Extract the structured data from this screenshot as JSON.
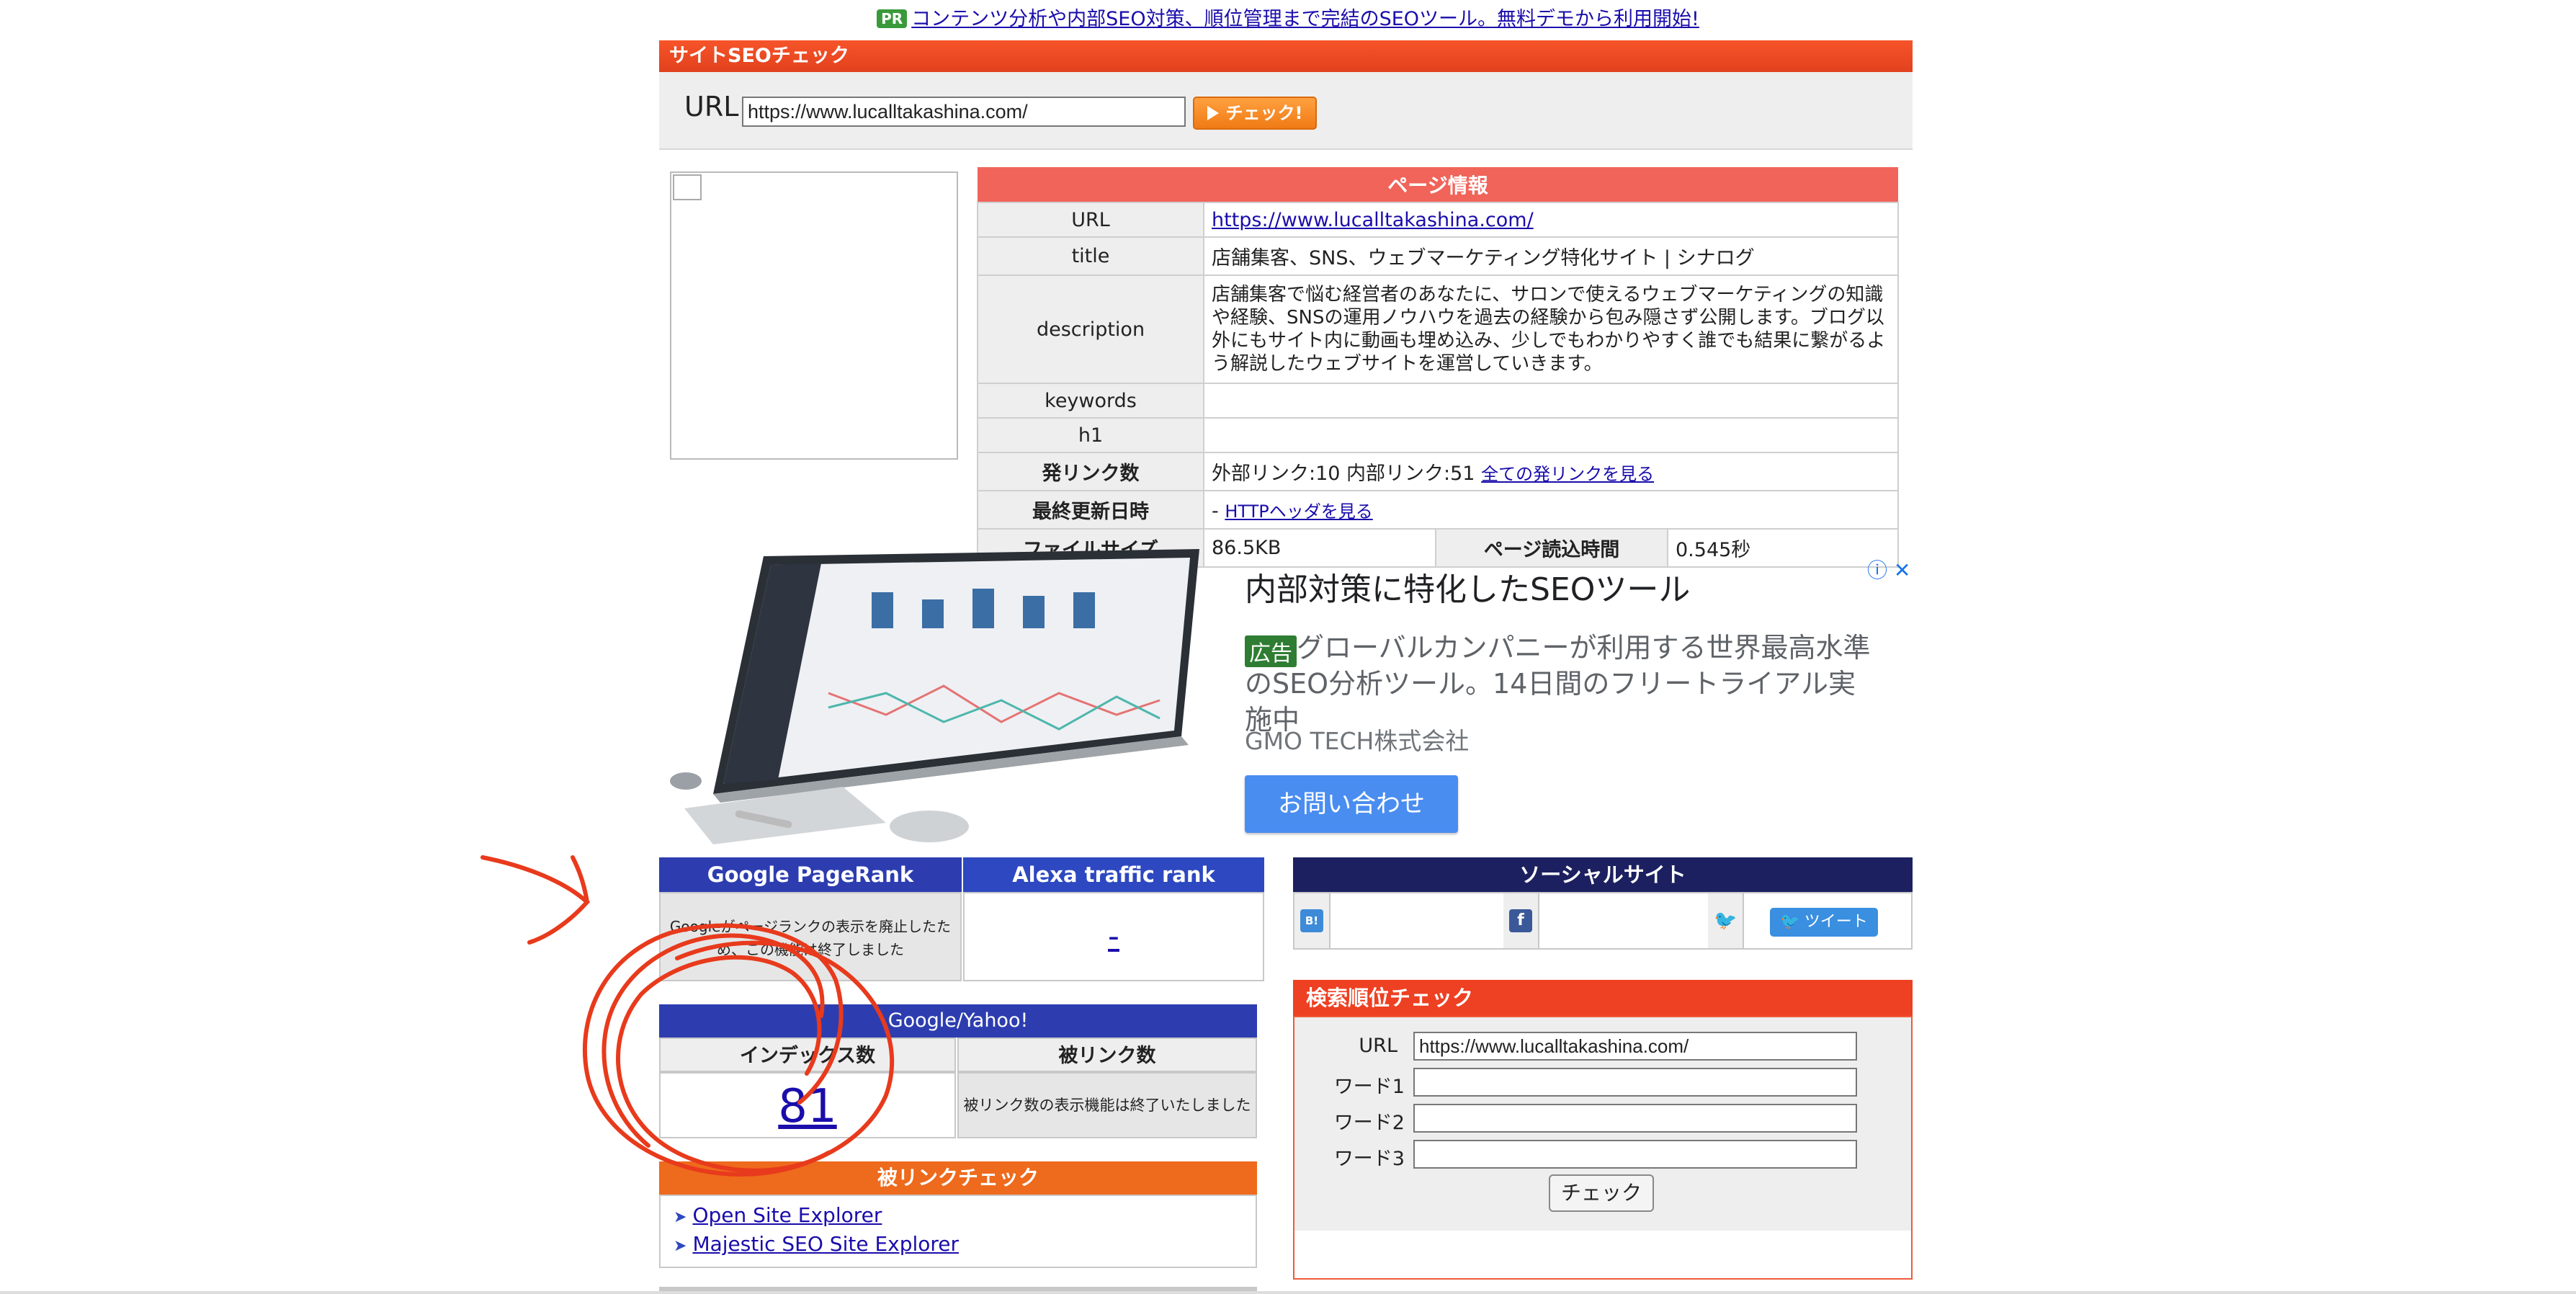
{
  "pr_banner": {
    "badge": "PR",
    "text": "コンテンツ分析や内部SEO対策、順位管理まで完結のSEOツール。無料デモから利用開始!"
  },
  "seo_check": {
    "title": "サイトSEOチェック",
    "url_label": "URL",
    "url_value": "https://www.lucalltakashina.com/",
    "check_button": "チェック!"
  },
  "page_info": {
    "header": "ページ情報",
    "rows": {
      "url_key": "URL",
      "url_value": "https://www.lucalltakashina.com/",
      "title_key": "title",
      "title_value": "店舗集客、SNS、ウェブマーケティング特化サイト | シナログ",
      "desc_key": "description",
      "desc_value": "店舗集客で悩む経営者のあなたに、サロンで使えるウェブマーケティングの知識や経験、SNSの運用ノウハウを過去の経験から包み隠さず公開します。ブログ以外にもサイト内に動画も埋め込み、少しでもわかりやすく誰でも結果に繋がるよう解説したウェブサイトを運営していきます。",
      "keywords_key": "keywords",
      "keywords_value": "",
      "h1_key": "h1",
      "h1_value": "",
      "links_key": "発リンク数",
      "links_value": "外部リンク:10 内部リンク:51",
      "links_link": "全ての発リンクを見る",
      "updated_key": "最終更新日時",
      "updated_value": "- ",
      "updated_link": "HTTPヘッダを見る",
      "filesize_key": "ファイルサイズ",
      "filesize_value": "86.5KB",
      "loadtime_key": "ページ読込時間",
      "loadtime_value": "0.545秒"
    }
  },
  "ad": {
    "title": "内部対策に特化したSEOツール",
    "tag": "広告",
    "description": "グローバルカンパニーが利用する世界最高水準のSEO分析ツール。14日間のフリートライアル実施中",
    "company": "GMO TECH株式会社",
    "button": "お問い合わせ",
    "close": "ⓘ ✕"
  },
  "rank": {
    "google_header": "Google PageRank",
    "alexa_header": "Alexa traffic rank",
    "google_text": "Googleがページランクの表示を廃止したため、この機能は終了しました",
    "alexa_value": "-"
  },
  "index": {
    "header": "Google/Yahoo!",
    "index_label": "インデックス数",
    "backlink_label": "被リンク数",
    "index_value": "81",
    "backlink_text": "被リンク数の表示機能は終了いたしました"
  },
  "backlink_check": {
    "header": "被リンクチェック",
    "links": [
      "Open Site Explorer",
      "Majestic SEO Site Explorer"
    ]
  },
  "social": {
    "header": "ソーシャルサイト",
    "tweet": "ツイート"
  },
  "search_rank": {
    "header": "検索順位チェック",
    "url_label": "URL",
    "url_value": "https://www.lucalltakashina.com/",
    "word1": "ワード1",
    "word2": "ワード2",
    "word3": "ワード3",
    "button": "チェック"
  },
  "colors": {
    "seo_header": "#e94a22",
    "info_header": "#f0645a",
    "navy": "#2d3db0",
    "social_header": "#1c2060",
    "search_header": "#ee4022",
    "annotation": "#e83a1c"
  }
}
